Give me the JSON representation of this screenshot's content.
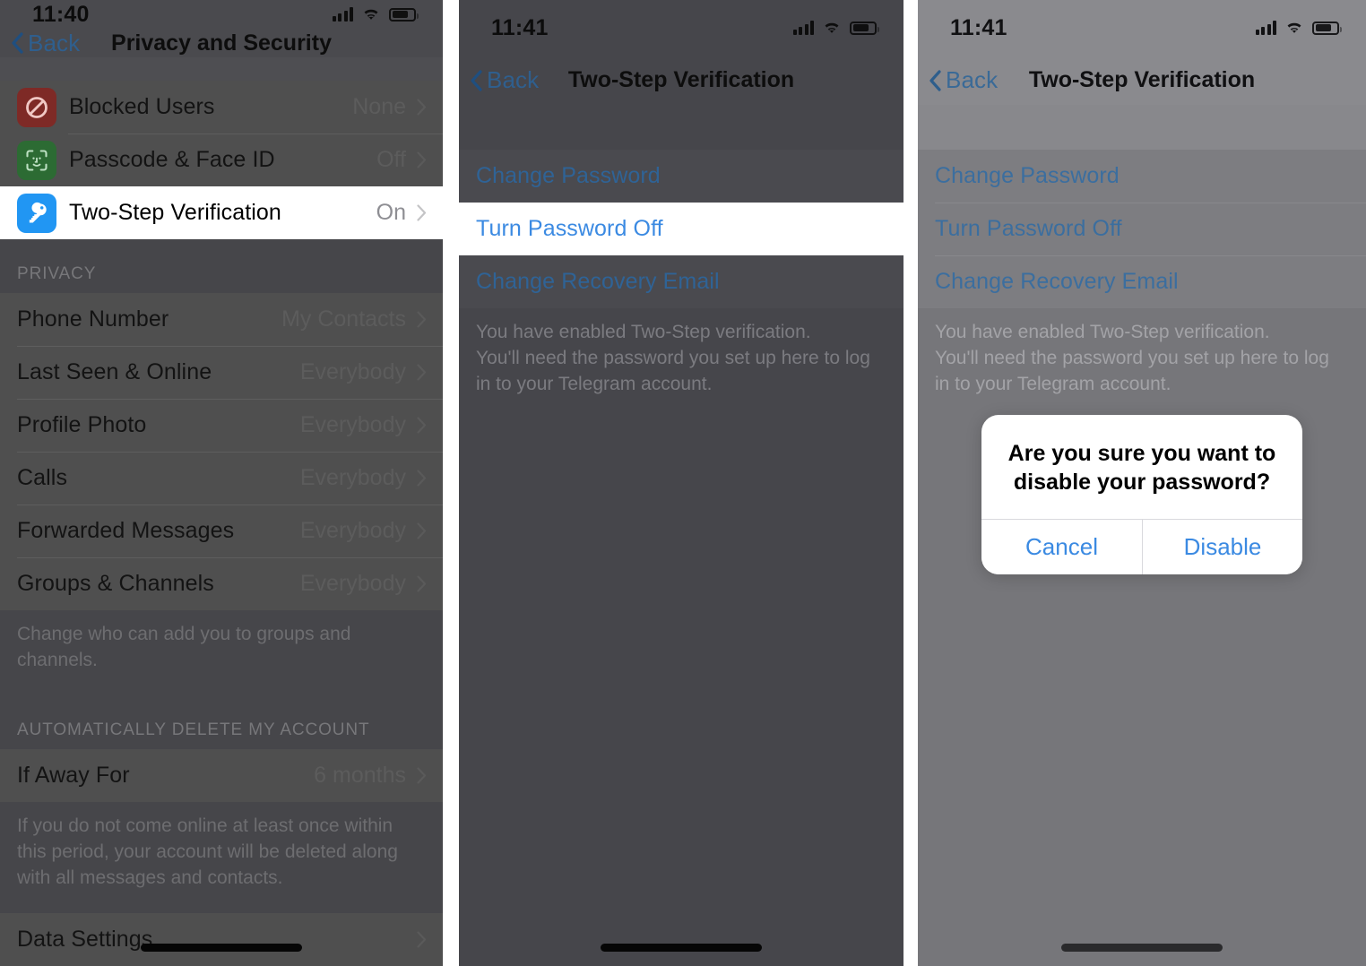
{
  "panels": [
    {
      "id": "privacy-and-security",
      "status_bar": {
        "time": "11:40",
        "signal_icon": "cellular-signal-icon",
        "wifi_icon": "wifi-icon",
        "battery_icon": "battery-icon"
      },
      "nav": {
        "back_label": "Back",
        "title": "Privacy and Security",
        "back_icon": "chevron-left-icon"
      },
      "groups": [
        {
          "rows": [
            {
              "icon": "blocked-users-icon",
              "label": "Blocked Users",
              "value": "None",
              "highlight": false
            },
            {
              "icon": "face-id-icon",
              "label": "Passcode & Face ID",
              "value": "Off",
              "highlight": false
            },
            {
              "icon": "key-icon",
              "label": "Two-Step Verification",
              "value": "On",
              "highlight": true
            }
          ]
        }
      ],
      "privacy_section": {
        "header": "PRIVACY",
        "rows": [
          {
            "label": "Phone Number",
            "value": "My Contacts"
          },
          {
            "label": "Last Seen & Online",
            "value": "Everybody"
          },
          {
            "label": "Profile Photo",
            "value": "Everybody"
          },
          {
            "label": "Calls",
            "value": "Everybody"
          },
          {
            "label": "Forwarded Messages",
            "value": "Everybody"
          },
          {
            "label": "Groups & Channels",
            "value": "Everybody"
          }
        ],
        "footnote": "Change who can add you to groups and channels."
      },
      "delete_section": {
        "header": "AUTOMATICALLY DELETE MY ACCOUNT",
        "rows": [
          {
            "label": "If Away For",
            "value": "6 months"
          }
        ],
        "footnote": "If you do not come online at least once within this period, your account will be deleted along with all messages and contacts."
      },
      "last_row": {
        "label": "Data Settings",
        "value": ""
      }
    },
    {
      "id": "two-step-verification-highlighted",
      "status_bar": {
        "time": "11:41",
        "signal_icon": "cellular-signal-icon",
        "wifi_icon": "wifi-icon",
        "battery_icon": "battery-icon"
      },
      "nav": {
        "back_label": "Back",
        "title": "Two-Step Verification",
        "back_icon": "chevron-left-icon"
      },
      "actions": [
        {
          "label": "Change Password",
          "highlight": false
        },
        {
          "label": "Turn Password Off",
          "highlight": true
        },
        {
          "label": "Change Recovery Email",
          "highlight": false
        }
      ],
      "footnote": "You have enabled Two-Step verification.\nYou'll need the password you set up here to log in to your Telegram account."
    },
    {
      "id": "two-step-verification-alert",
      "status_bar": {
        "time": "11:41",
        "signal_icon": "cellular-signal-icon",
        "wifi_icon": "wifi-icon",
        "battery_icon": "battery-icon"
      },
      "nav": {
        "back_label": "Back",
        "title": "Two-Step Verification",
        "back_icon": "chevron-left-icon"
      },
      "actions": [
        {
          "label": "Change Password",
          "highlight": false
        },
        {
          "label": "Turn Password Off",
          "highlight": false
        },
        {
          "label": "Change Recovery Email",
          "highlight": false
        }
      ],
      "footnote": "You have enabled Two-Step verification.\nYou'll need the password you set up here to log in to your Telegram account.",
      "alert": {
        "title": "Are you sure you want to disable your password?",
        "cancel_label": "Cancel",
        "confirm_label": "Disable"
      }
    }
  ],
  "colors": {
    "ios_blue": "#3b8ae2",
    "link_blue_dim_p2": "#2f6396",
    "link_blue_dim_p3": "#3b6e9f",
    "blocked_icon_bg": "#7e2a26",
    "faceid_icon_bg": "#2c6b33",
    "key_icon_bg": "#2196f3",
    "highlight_bg": "#ffffff"
  }
}
